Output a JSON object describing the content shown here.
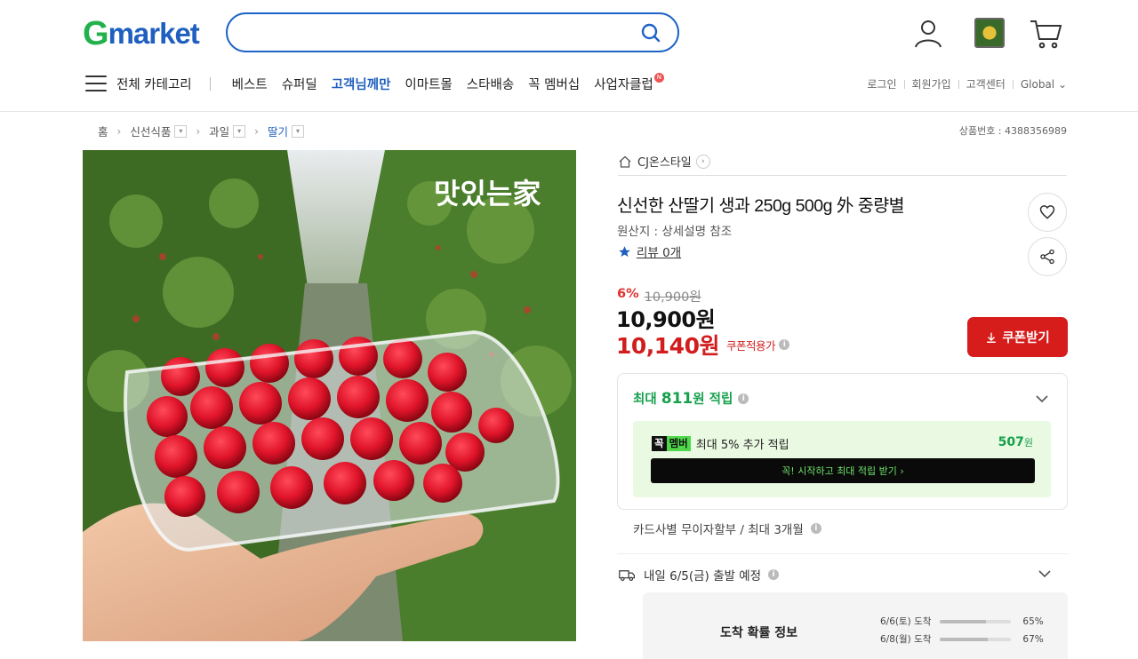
{
  "header": {
    "logo_g": "G",
    "logo_rest": "market",
    "search_value": "",
    "nav": {
      "all_categories": "전체 카테고리",
      "items": [
        "베스트",
        "슈퍼딜",
        "고객님께만",
        "이마트몰",
        "스타배송",
        "꼭 멤버십",
        "사업자클럽"
      ],
      "new_badge": "N"
    },
    "util": [
      "로그인",
      "회원가입",
      "고객센터",
      "Global ⌄"
    ]
  },
  "breadcrumb": {
    "home": "홈",
    "level1": "신선식품",
    "level2": "과일",
    "level3": "딸기"
  },
  "product_number": "상품번호 : 4388356989",
  "image": {
    "watermark": "맛있는家"
  },
  "seller": "CJ온스타일",
  "product": {
    "title": "신선한 산딸기 생과 250g 500g 外 중량별",
    "origin": "원산지 : 상세설명 참조",
    "review": "리뷰 0개",
    "discount_pct": "6%",
    "original_price": "10,900원",
    "price": "10,900원",
    "coupon_price": "10,140원",
    "coupon_note": "쿠폰적용가",
    "coupon_button": "쿠폰받기"
  },
  "points": {
    "prefix": "최대 ",
    "amount": "811",
    "suffix": "원 적립",
    "member_badge_k": "꼭",
    "member_badge_m": "멤버",
    "member_text": "최대 5% 추가 적립",
    "member_amount": "507",
    "member_amount_unit": "원",
    "member_button": "꼭! 시작하고 최대 적립 받기  ›"
  },
  "installment": "카드사별 무이자할부 / 최대 3개월",
  "shipping": "내일 6/5(금) 출발 예정",
  "arrival": {
    "title": "도착 확률 정보",
    "rows": [
      {
        "date": "6/6(토) 도착",
        "pct": "65%",
        "value": 0.65
      },
      {
        "date": "6/8(월) 도착",
        "pct": "67%",
        "value": 0.67
      }
    ]
  },
  "colors": {
    "brand_green": "#22b14c",
    "brand_blue": "#1f5fbf",
    "sale_red": "#d11d1d",
    "point_green": "#15a04b"
  },
  "icons": [
    "search-icon",
    "user-icon",
    "cart-icon",
    "heart-icon",
    "share-icon",
    "star-icon",
    "home-icon",
    "truck-icon",
    "download-icon",
    "chevron-down-icon"
  ]
}
